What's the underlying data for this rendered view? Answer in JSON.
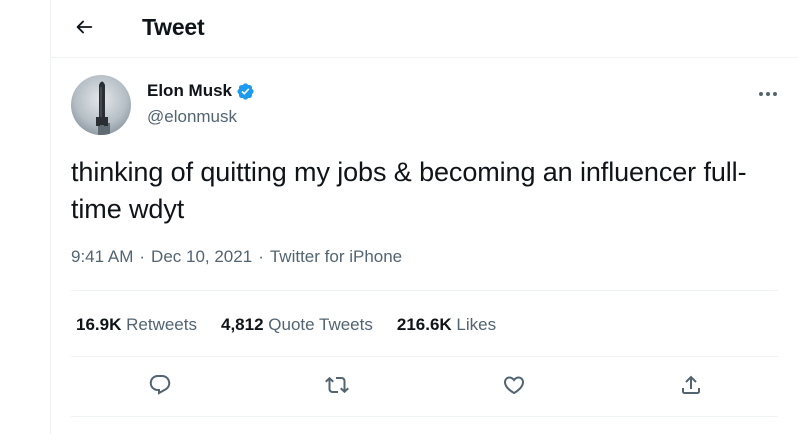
{
  "header": {
    "title": "Tweet",
    "back_icon": "arrow-left-icon"
  },
  "author": {
    "display_name": "Elon Musk",
    "handle": "@elonmusk",
    "verified_icon": "verified-badge-icon",
    "verified_color": "#1d9bf0"
  },
  "tweet": {
    "text": "thinking of quitting my jobs & becoming an influencer full-time wdyt",
    "time": "9:41 AM",
    "separator": "·",
    "date": "Dec 10, 2021",
    "source": "Twitter for iPhone"
  },
  "stats": [
    {
      "value": "16.9K",
      "label": "Retweets"
    },
    {
      "value": "4,812",
      "label": "Quote Tweets"
    },
    {
      "value": "216.6K",
      "label": "Likes"
    }
  ],
  "actions": [
    {
      "icon": "reply-icon"
    },
    {
      "icon": "retweet-icon"
    },
    {
      "icon": "like-icon"
    },
    {
      "icon": "share-icon"
    }
  ],
  "colors": {
    "text": "#0f1419",
    "secondary": "#536471",
    "border": "#eff3f4",
    "accent": "#1d9bf0"
  }
}
